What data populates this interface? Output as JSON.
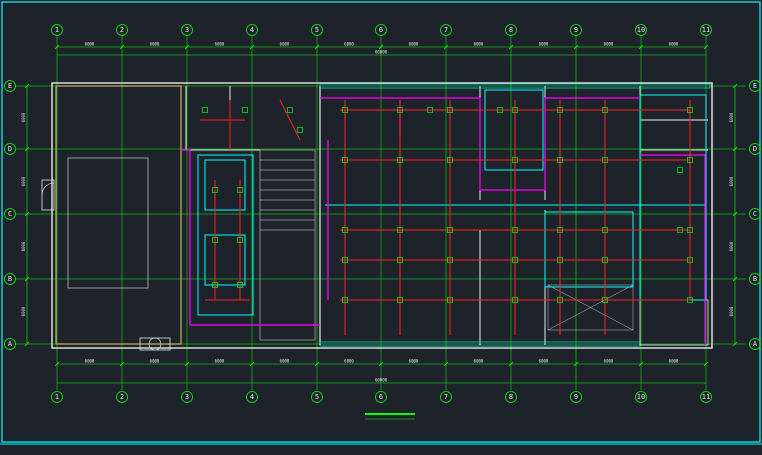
{
  "grid": {
    "columns": [
      "1",
      "2",
      "3",
      "4",
      "5",
      "6",
      "7",
      "8",
      "9",
      "10",
      "11"
    ],
    "rows": [
      "E",
      "D",
      "C",
      "B",
      "A"
    ]
  },
  "dimensions": {
    "top_segments": [
      "6000",
      "6000",
      "6000",
      "6000",
      "6000",
      "6000",
      "6000",
      "6000",
      "6000",
      "6000"
    ],
    "top_total": "60000",
    "bottom_segments": [
      "6000",
      "6000",
      "6000",
      "6000",
      "6000",
      "6000",
      "6000",
      "6000",
      "6000",
      "6000"
    ],
    "bottom_total": "60000",
    "left_segments": [
      "6000",
      "6000",
      "6000",
      "6000"
    ],
    "right_segments": [
      "6000",
      "6000",
      "6000",
      "6000"
    ]
  },
  "legend": {
    "title": "",
    "entries": [],
    "notes": []
  },
  "rooms": [],
  "fixtures": [],
  "drawing_title": "",
  "colors": {
    "background": "#1e232b",
    "grid_line": "#00ff00",
    "wall": "#e8e8e8",
    "circuit": "#ff2020",
    "trunk": "#ff00ff",
    "cyan": "#00ffff",
    "text": "#ffff00",
    "bubble": "#00ff00"
  }
}
